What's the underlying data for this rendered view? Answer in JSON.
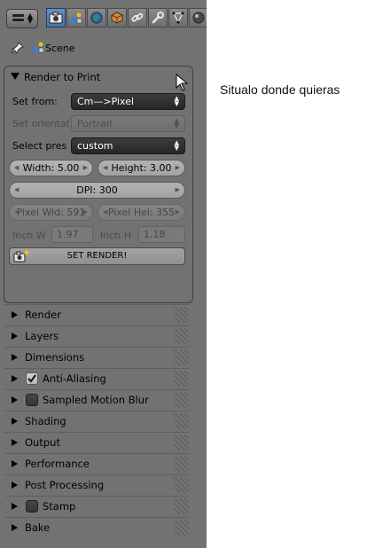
{
  "header": {
    "editor_type_icon": "properties-editor-icon",
    "tabs": [
      {
        "name": "render-tab",
        "icon": "camera-icon",
        "active": true
      },
      {
        "name": "scene-tab",
        "icon": "scene-icon",
        "active": false
      },
      {
        "name": "world-tab",
        "icon": "world-icon",
        "active": false
      },
      {
        "name": "object-tab",
        "icon": "cube-icon",
        "active": false
      },
      {
        "name": "constraints-tab",
        "icon": "chain-icon",
        "active": false
      },
      {
        "name": "modifiers-tab",
        "icon": "wrench-icon",
        "active": false
      },
      {
        "name": "mesh-data-tab",
        "icon": "vertex-icon",
        "active": false
      },
      {
        "name": "material-tab",
        "icon": "material-icon",
        "active": false
      }
    ]
  },
  "context": {
    "pin_icon": "pin-icon",
    "scene_label": "Scene"
  },
  "render_to_print": {
    "title": "Render to Print",
    "set_from": {
      "label": "Set from:",
      "value": "Cm—>Pixel"
    },
    "set_orientation": {
      "label": "Set orientat",
      "value": "Portrait"
    },
    "select_preset": {
      "label": "Select pres",
      "value": "custom"
    },
    "width": "Width: 5.00",
    "height": "Height: 3.00",
    "dpi": "DPI: 300",
    "pixel_width": "Pixel Wid: 591",
    "pixel_height": "Pixel Hei: 355",
    "inch_w": {
      "label": "Inch W",
      "value": "1.97"
    },
    "inch_h": {
      "label": "Inch H",
      "value": "1.18"
    },
    "set_render": "SET RENDER!"
  },
  "sections": [
    {
      "label": "Render",
      "checkbox": null
    },
    {
      "label": "Layers",
      "checkbox": null
    },
    {
      "label": "Dimensions",
      "checkbox": null
    },
    {
      "label": "Anti-Aliasing",
      "checkbox": true
    },
    {
      "label": "Sampled Motion Blur",
      "checkbox": false
    },
    {
      "label": "Shading",
      "checkbox": null
    },
    {
      "label": "Output",
      "checkbox": null
    },
    {
      "label": "Performance",
      "checkbox": null
    },
    {
      "label": "Post Processing",
      "checkbox": null
    },
    {
      "label": "Stamp",
      "checkbox": false
    },
    {
      "label": "Bake",
      "checkbox": null
    }
  ],
  "caption": "Situalo donde quieras",
  "colors": {
    "panel_bg": "#727272",
    "active_tab": "#5a7fba",
    "menu_bg": "#2e2e2e"
  }
}
